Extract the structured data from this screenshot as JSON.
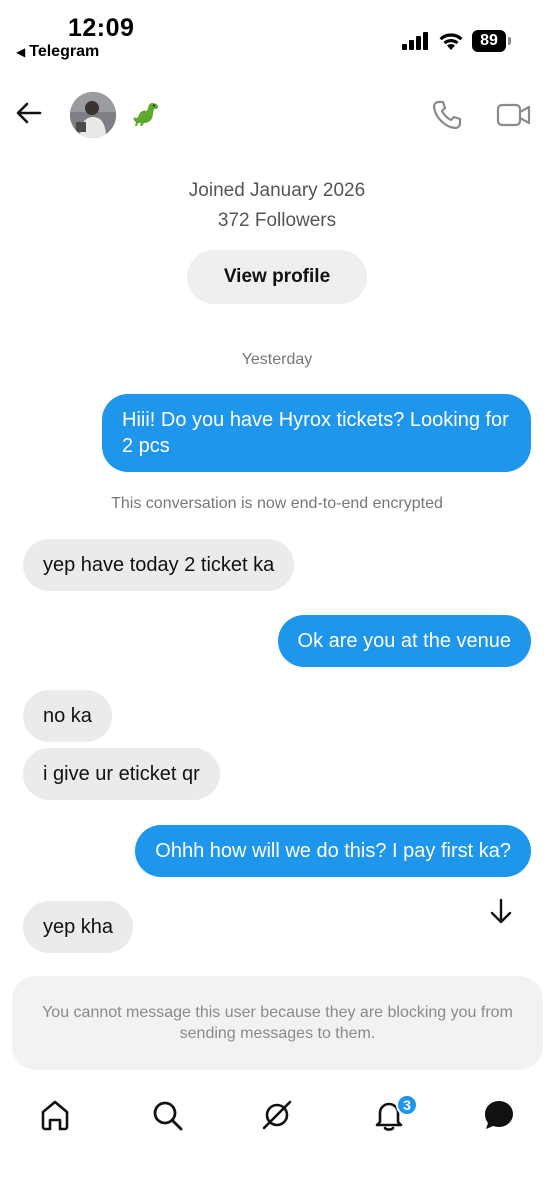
{
  "status_bar": {
    "time": "12:09",
    "back_app": "Telegram",
    "battery": "89",
    "icons": [
      "signal-icon",
      "wifi-icon",
      "battery-icon"
    ]
  },
  "header": {
    "contact_emoji": "🦖",
    "icons": [
      "back-arrow-icon",
      "avatar",
      "phone-icon",
      "video-camera-icon"
    ]
  },
  "profile": {
    "joined": "Joined January 2026",
    "followers": "372 Followers",
    "view_profile_label": "View profile"
  },
  "chat": {
    "date_separator": "Yesterday",
    "system_note": "This conversation is now end-to-end encrypted",
    "messages": [
      {
        "direction": "outgoing",
        "text": "Hiii! Do you have Hyrox tickets? Looking for 2 pcs"
      },
      {
        "direction": "incoming",
        "text": "yep have today 2 ticket ka"
      },
      {
        "direction": "outgoing",
        "text": "Ok are you at the venue"
      },
      {
        "direction": "incoming",
        "text": "no ka"
      },
      {
        "direction": "incoming",
        "text": "i give ur eticket qr"
      },
      {
        "direction": "outgoing",
        "text": "Ohhh how will we do this? I pay first ka?"
      },
      {
        "direction": "incoming",
        "text": "yep kha"
      }
    ]
  },
  "blocked_notice": "You cannot message this user because they are blocking you from sending messages to them.",
  "bottom_nav": {
    "items": [
      "home-icon",
      "search-icon",
      "explore-icon",
      "notifications-icon",
      "messages-icon"
    ],
    "notification_badge": "3"
  },
  "colors": {
    "accent": "#1e96ec",
    "incoming_bubble": "#ebebeb",
    "muted_text": "#777777"
  }
}
